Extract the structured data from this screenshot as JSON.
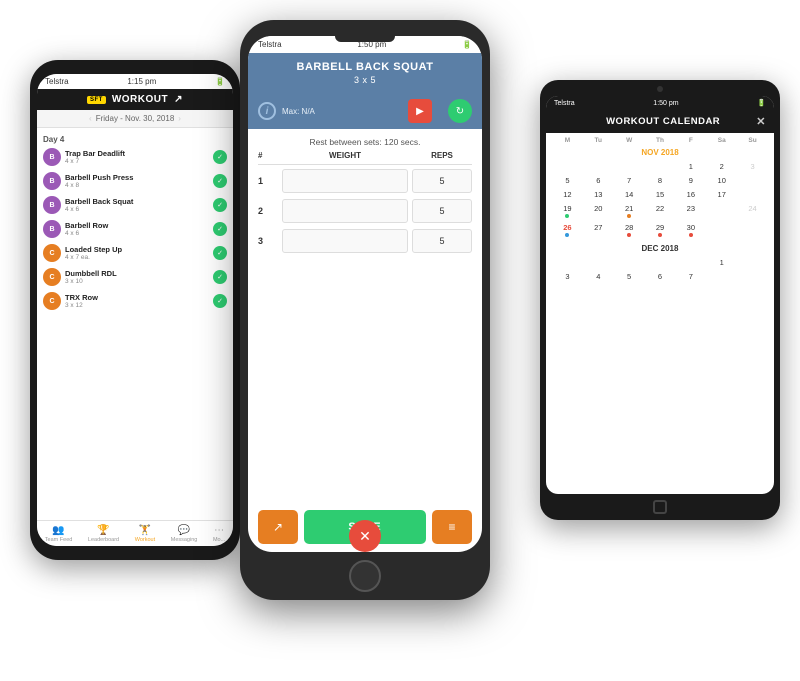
{
  "scene": {
    "bg_color": "#ffffff"
  },
  "phone_left": {
    "status": {
      "carrier": "Telstra",
      "time": "1:15 pm",
      "signal": "▂▄▆",
      "wifi": "WiFi"
    },
    "header": {
      "logo": "SFT",
      "title": "WORKOUT",
      "icon": "↗"
    },
    "date": "Friday - Nov. 30, 2018",
    "day_label": "Day 4",
    "workouts": [
      {
        "name": "Trap Bar Deadlift",
        "sets": "4 x 7",
        "icon": "B",
        "color": "icon-b",
        "done": true
      },
      {
        "name": "Barbell Push Press",
        "sets": "4 x 8",
        "icon": "B",
        "color": "icon-b",
        "done": true
      },
      {
        "name": "Barbell Back Squat",
        "sets": "4 x 6",
        "icon": "B",
        "color": "icon-b",
        "done": true
      },
      {
        "name": "Barbell Row",
        "sets": "4 x 6",
        "icon": "B",
        "color": "icon-b",
        "done": true
      },
      {
        "name": "Loaded Step Up",
        "sets": "4 x 7 ea.",
        "icon": "C",
        "color": "icon-c",
        "done": true
      },
      {
        "name": "Dumbbell RDL",
        "sets": "3 x 10",
        "icon": "C",
        "color": "icon-c",
        "done": true
      },
      {
        "name": "TRX Row",
        "sets": "3 x 12",
        "icon": "C",
        "color": "icon-c",
        "done": true
      }
    ],
    "nav": [
      {
        "label": "Team Feed",
        "icon": "👥",
        "active": false
      },
      {
        "label": "Leaderboard",
        "icon": "🏆",
        "active": false
      },
      {
        "label": "Workout",
        "icon": "🏋",
        "active": true
      },
      {
        "label": "Messaging",
        "icon": "💬",
        "active": false
      },
      {
        "label": "More",
        "icon": "⋯",
        "active": false
      }
    ]
  },
  "phone_center": {
    "status": {
      "carrier": "Telstra",
      "time": "1:50 pm",
      "bluetooth": "BT",
      "battery": "Battery"
    },
    "exercise": {
      "title": "BARBELL BACK SQUAT",
      "sets_reps": "3 x 5"
    },
    "max_info": "Max: N/A",
    "rest_text": "Rest between sets: 120 secs.",
    "table": {
      "headers": [
        "#",
        "WEIGHT",
        "REPS"
      ],
      "rows": [
        {
          "num": "1",
          "reps": "5"
        },
        {
          "num": "2",
          "reps": "5"
        },
        {
          "num": "3",
          "reps": "5"
        }
      ]
    },
    "buttons": {
      "share": "↗",
      "save": "SAVE",
      "list": "≡"
    },
    "close_btn": "✕"
  },
  "tablet_right": {
    "status": {
      "carrier": "Telstra",
      "time": "1:50 pm",
      "bluetooth": "BT",
      "battery": "Battery"
    },
    "header": {
      "title": "WORKOUT CALENDAR",
      "close": "✕"
    },
    "calendar": {
      "dow": [
        "M",
        "Tu",
        "W",
        "Th",
        "F",
        "Sa",
        "Su"
      ],
      "nov_label": "NOV 2018",
      "nov_weeks": [
        [
          null,
          null,
          null,
          null,
          "1",
          "2",
          "3"
        ],
        [
          "5",
          "6",
          "7",
          "8",
          "9",
          "10",
          null
        ],
        [
          "12",
          "13",
          "14",
          "15",
          "16",
          "17",
          null
        ],
        [
          "19",
          "20",
          "21",
          "22",
          "23",
          null,
          "24"
        ],
        [
          "26",
          "27",
          "28",
          "29",
          "30",
          null,
          null
        ]
      ],
      "nov_dots": {
        "19": "green",
        "21": "orange",
        "26": "blue",
        "28": "red",
        "29": "red",
        "30": "red"
      },
      "dec_label": "DEC 2018",
      "dec_weeks": [
        [
          null,
          null,
          null,
          null,
          null,
          "1",
          null
        ],
        [
          "3",
          "4",
          "5",
          "6",
          "7",
          null,
          null
        ]
      ]
    }
  }
}
